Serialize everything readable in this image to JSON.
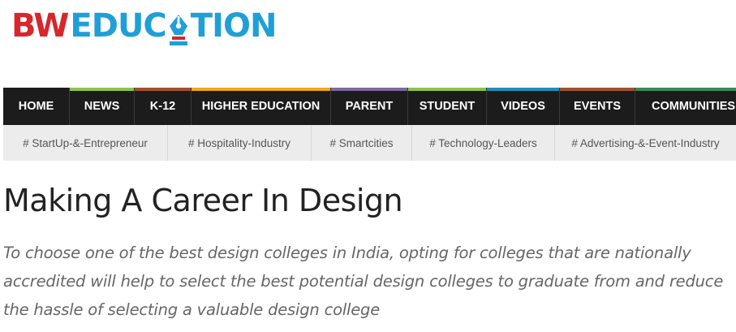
{
  "logo": {
    "part1": "BW",
    "part2a": "EDUC",
    "part2b": "TION",
    "pen_color": "#d7262c",
    "brand_blue": "#1f9fd8"
  },
  "nav": {
    "items": [
      {
        "label": "HOME",
        "accent": "#1c1c1c"
      },
      {
        "label": "NEWS",
        "accent": "#8bc34a"
      },
      {
        "label": "K-12",
        "accent": "#a0522d"
      },
      {
        "label": "HIGHER EDUCATION",
        "accent": "#f0a81c"
      },
      {
        "label": "PARENT",
        "accent": "#7d6a9b"
      },
      {
        "label": "STUDENT",
        "accent": "#8bc34a"
      },
      {
        "label": "VIDEOS",
        "accent": "#1f8fb5"
      },
      {
        "label": "EVENTS",
        "accent": "#a0522d"
      },
      {
        "label": "COMMUNITIES",
        "accent": "#3a8a5a"
      }
    ]
  },
  "tags": [
    "# StartUp-&-Entrepreneur",
    "# Hospitality-Industry",
    "# Smartcities",
    "# Technology-Leaders",
    "# Advertising-&-Event-Industry"
  ],
  "article": {
    "title": "Making A Career In Design",
    "summary": "To choose one of the best design colleges in India, opting for colleges that are nationally accredited will help to select the best potential design colleges to graduate from and reduce the hassle of selecting a valuable design college"
  }
}
